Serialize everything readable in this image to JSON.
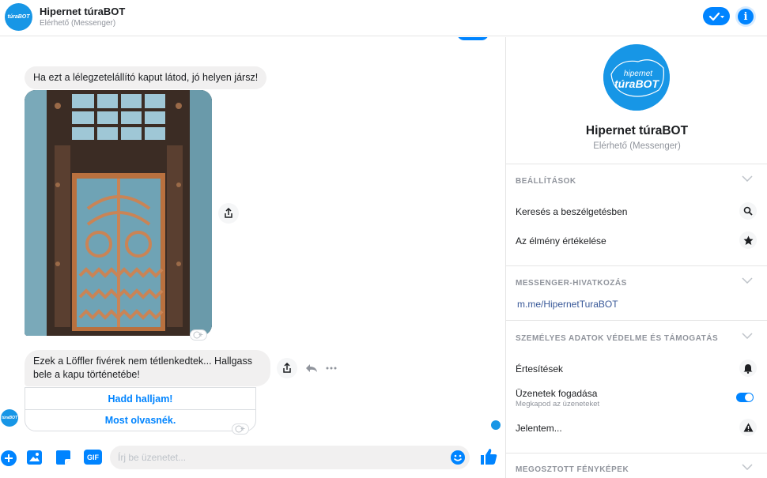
{
  "header": {
    "title": "Hipernet túraBOT",
    "subtitle": "Elérhető (Messenger)",
    "avatar_text": "túraBOT"
  },
  "conversation": {
    "message1": "Ha ezt a lélegzetelállító kaput látod, jó helyen jársz!",
    "message2": "Ezek a Löffler fivérek nem tétlenkedtek... Hallgass bele a kapu történetébe!",
    "quick_replies": [
      "Hadd halljam!",
      "Most olvasnék."
    ]
  },
  "composer": {
    "placeholder": "Írj be üzenetet..."
  },
  "panel": {
    "name": "Hipernet túraBOT",
    "status": "Elérhető (Messenger)",
    "avatar_top": "hipernet",
    "avatar_bottom": "túraBOT",
    "sections": {
      "settings": {
        "title": "BEÁLLÍTÁSOK",
        "items": [
          "Keresés a beszélgetésben",
          "Az élmény értékelése"
        ]
      },
      "link": {
        "title": "MESSENGER-HIVATKOZÁS",
        "url": "m.me/HipernetTuraBOT"
      },
      "privacy": {
        "title": "SZEMÉLYES ADATOK VÉDELME ÉS TÁMOGATÁS",
        "notifications": "Értesítések",
        "receive": "Üzenetek fogadása",
        "receive_sub": "Megkapod az üzeneteket",
        "report": "Jelentem..."
      },
      "photos": {
        "title": "MEGOSZTOTT FÉNYKÉPEK"
      }
    }
  },
  "colors": {
    "accent": "#0084ff",
    "brand": "#1796e6",
    "bubble": "#f1f0f0"
  }
}
